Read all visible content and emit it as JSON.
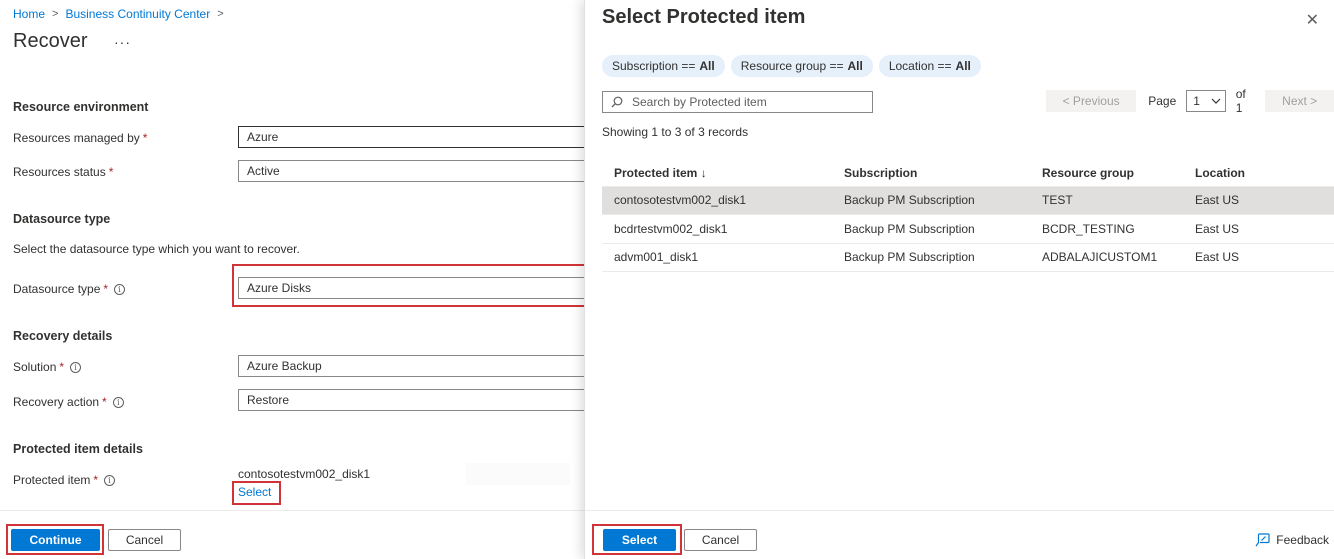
{
  "breadcrumb": {
    "home": "Home",
    "bcc": "Business Continuity Center"
  },
  "page": {
    "title": "Recover",
    "more": "···"
  },
  "resource_env": {
    "heading": "Resource environment",
    "managed_by_label": "Resources managed by",
    "managed_by_value": "Azure",
    "status_label": "Resources status",
    "status_value": "Active"
  },
  "datasource": {
    "heading": "Datasource type",
    "description": "Select the datasource type which you want to recover.",
    "type_label": "Datasource type",
    "type_value": "Azure Disks"
  },
  "recovery": {
    "heading": "Recovery details",
    "solution_label": "Solution",
    "solution_value": "Azure Backup",
    "action_label": "Recovery action",
    "action_value": "Restore"
  },
  "protected": {
    "heading": "Protected item details",
    "item_label": "Protected item",
    "item_value": "contosotestvm002_disk1",
    "select_link": "Select"
  },
  "required_mark": "*",
  "info_glyph": "i",
  "left_footer": {
    "continue": "Continue",
    "cancel": "Cancel"
  },
  "panel": {
    "title": "Select Protected item",
    "close": "✕",
    "filters": [
      {
        "key": "Subscription ==",
        "value": "All"
      },
      {
        "key": "Resource group ==",
        "value": "All"
      },
      {
        "key": "Location ==",
        "value": "All"
      }
    ],
    "search_placeholder": "Search by Protected item",
    "pager": {
      "previous": "< Previous",
      "page_label": "Page",
      "page_value": "1",
      "of": "of 1",
      "next": "Next >"
    },
    "records": "Showing 1 to 3 of 3 records",
    "columns": [
      "Protected item ↓",
      "Subscription",
      "Resource group",
      "Location"
    ],
    "rows": [
      [
        "contosotestvm002_disk1",
        "Backup PM Subscription",
        "TEST",
        "East US"
      ],
      [
        "bcdrtestvm002_disk1",
        "Backup PM Subscription",
        "BCDR_TESTING",
        "East US"
      ],
      [
        "advm001_disk1",
        "Backup PM Subscription",
        "ADBALAJICUSTOM1",
        "East US"
      ]
    ],
    "select": "Select",
    "cancel": "Cancel",
    "feedback": "Feedback"
  },
  "colors": {
    "accent": "#0078d4",
    "highlight": "#d13438",
    "selected_row": "#e1dfdd",
    "pill": "#e6f0fa"
  }
}
